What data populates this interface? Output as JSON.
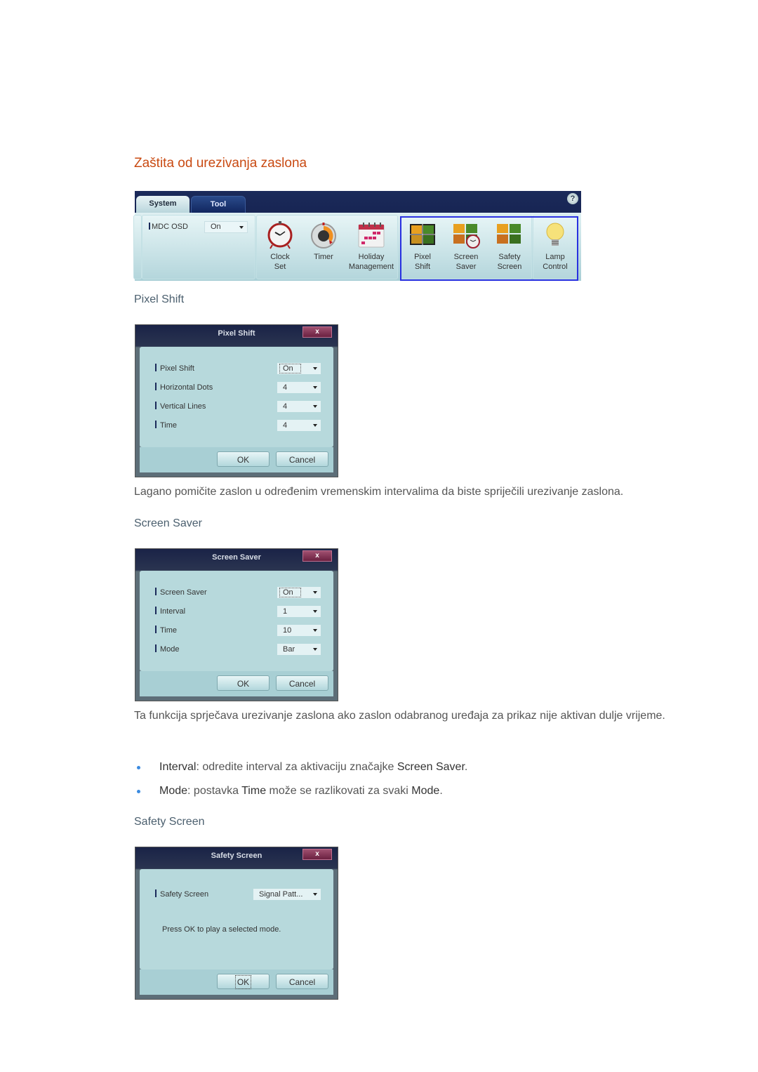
{
  "page": {
    "title": "Zaštita od urezivanja zaslona",
    "toolbar": {
      "tabs": [
        {
          "label": "System",
          "active": true
        },
        {
          "label": "Tool",
          "active": false
        }
      ],
      "help_label": "?",
      "mdc_osd": {
        "label": "MDC OSD",
        "value": "On"
      },
      "items": [
        {
          "icon": "alarm-clock-icon",
          "line1": "Clock",
          "line2": "Set"
        },
        {
          "icon": "timer-icon",
          "line1": "Timer",
          "line2": ""
        },
        {
          "icon": "calendar-icon",
          "line1": "Holiday",
          "line2": "Management"
        },
        {
          "icon": "pixel-shift-icon",
          "line1": "Pixel",
          "line2": "Shift"
        },
        {
          "icon": "screen-saver-icon",
          "line1": "Screen",
          "line2": "Saver"
        },
        {
          "icon": "safety-screen-icon",
          "line1": "Safety",
          "line2": "Screen"
        },
        {
          "icon": "lightbulb-icon",
          "line1": "Lamp",
          "line2": "Control"
        }
      ]
    },
    "sections": {
      "pixel_shift": {
        "heading": "Pixel Shift",
        "dialog": {
          "title": "Pixel Shift",
          "close": "x",
          "rows": [
            {
              "label": "Pixel Shift",
              "value": "On"
            },
            {
              "label": "Horizontal Dots",
              "value": "4"
            },
            {
              "label": "Vertical Lines",
              "value": "4"
            },
            {
              "label": "Time",
              "value": "4"
            }
          ],
          "ok": "OK",
          "cancel": "Cancel"
        },
        "description": "Lagano pomičite zaslon u određenim vremenskim intervalima da biste spriječili urezivanje zaslona."
      },
      "screen_saver": {
        "heading": "Screen Saver",
        "dialog": {
          "title": "Screen Saver",
          "close": "x",
          "rows": [
            {
              "label": "Screen Saver",
              "value": "On"
            },
            {
              "label": "Interval",
              "value": "1"
            },
            {
              "label": "Time",
              "value": "10"
            },
            {
              "label": "Mode",
              "value": "Bar"
            }
          ],
          "ok": "OK",
          "cancel": "Cancel"
        },
        "description": "Ta funkcija sprječava urezivanje zaslona ako zaslon odabranog uređaja za prikaz nije aktivan dulje vrijeme.",
        "bullets": [
          {
            "term": "Interval",
            "text1": ": odredite interval za aktivaciju značajke ",
            "term2": "Screen Saver",
            "text2": ".",
            "term3": "",
            "text3": ""
          },
          {
            "term": "Mode",
            "text1": ": postavka ",
            "term2": "Time",
            "text2": " može se razlikovati za svaki ",
            "term3": "Mode",
            "text3": "."
          }
        ]
      },
      "safety_screen": {
        "heading": "Safety Screen",
        "dialog": {
          "title": "Safety Screen",
          "close": "x",
          "rows": [
            {
              "label": "Safety Screen",
              "value": "Signal Patt..."
            }
          ],
          "message": "Press OK to play a selected mode.",
          "ok": "OK",
          "cancel": "Cancel"
        }
      }
    }
  }
}
